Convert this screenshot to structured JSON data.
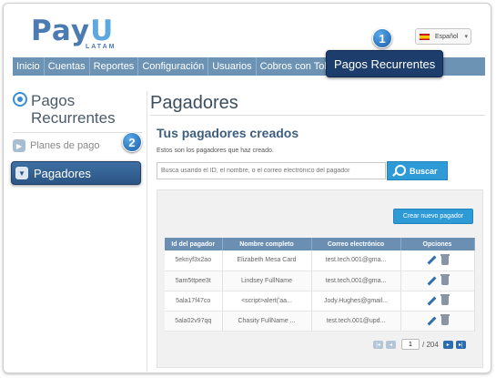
{
  "brand": {
    "logo_main": "Pay",
    "logo_u": "U",
    "logo_sub": "LATAM"
  },
  "language": {
    "selected": "Español"
  },
  "nav": {
    "items": [
      "Inicio",
      "Cuentas",
      "Reportes",
      "Configuración",
      "Usuarios",
      "Cobros con Token"
    ],
    "active": "Pagos Recurrentes"
  },
  "callouts": {
    "first": "1",
    "second": "2"
  },
  "sidebar": {
    "title_line1": "Pagos",
    "title_line2": "Recurrentes",
    "items": [
      {
        "label": "Planes de pago",
        "active": false
      },
      {
        "label": "Pagadores",
        "active": true
      }
    ]
  },
  "main": {
    "page_title": "Pagadores",
    "section_title": "Tus pagadores creados",
    "description": "Estos son los pagadores que haz creado.",
    "search": {
      "placeholder": "Busca usando el ID, el nombre, o el correo electrónico del pagador",
      "button_label": "Buscar"
    },
    "new_button_label": "Crear nuevo pagador",
    "table": {
      "columns": [
        "Id del pagador",
        "Nombre completo",
        "Correo electrónico",
        "Opciones"
      ],
      "rows": [
        {
          "id": "5eknyf3x2ao",
          "name": "Elizabeth Mesa Card",
          "email": "test.tech.001@gma..."
        },
        {
          "id": "5am5ttpee3t",
          "name": "Lindsey FullName",
          "email": "test.tech.001@gma..."
        },
        {
          "id": "5ala17f47co",
          "name": "<script>alert('aa...",
          "email": "Jody.Hughes@gmail..."
        },
        {
          "id": "5ala02v97qq",
          "name": "Chasity FullName ...",
          "email": "test.tech.001@upd..."
        }
      ]
    },
    "pager": {
      "first": "|◂",
      "prev": "◂",
      "current_page": "1",
      "total_text": "/ 204",
      "next": "▸",
      "last": "▸|"
    }
  },
  "colors": {
    "nav_bg": "#6c93b4",
    "active_dark": "#1d3e6d",
    "accent_blue": "#2f9bd6",
    "table_header": "#6a8fb3"
  },
  "icons": [
    "language-flag-icon",
    "chevron-down-icon",
    "recurring-payments-icon",
    "arrow-right-icon",
    "arrow-down-icon",
    "search-icon",
    "edit-icon",
    "delete-icon"
  ]
}
